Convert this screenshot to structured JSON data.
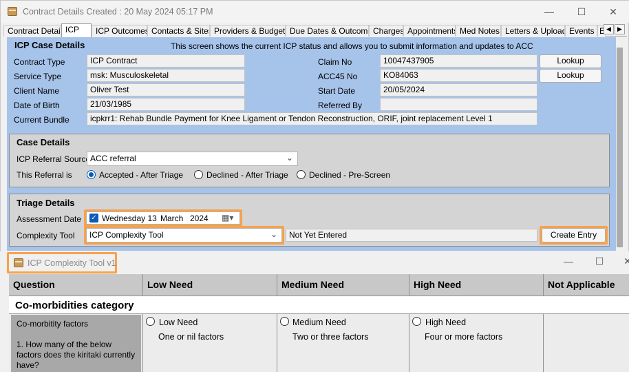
{
  "window": {
    "title": "Contract Details Created : 20 May 2024 05:17 PM"
  },
  "tabs": [
    "Contract Details",
    "ICP",
    "ICP Outcomes",
    "Contacts & Sites",
    "Providers & Budgets",
    "Due Dates & Outcomes",
    "Charges",
    "Appointments",
    "Med Notes",
    "Letters & Uploads",
    "Events",
    "E"
  ],
  "active_tab": "ICP",
  "icp": {
    "heading": "ICP Case Details",
    "info": "This screen shows the current ICP status and allows you to submit information and updates to ACC",
    "contract_type_label": "Contract Type",
    "contract_type": "ICP Contract",
    "service_type_label": "Service Type",
    "service_type": "msk: Musculoskeletal",
    "client_name_label": "Client Name",
    "client_name": "Oliver Test",
    "dob_label": "Date of Birth",
    "dob": "21/03/1985",
    "bundle_label": "Current Bundle",
    "bundle": "icpkrr1: Rehab Bundle Payment for Knee Ligament or Tendon Reconstruction, ORIF, joint replacement Level 1",
    "claim_no_label": "Claim No",
    "claim_no": "10047437905",
    "acc45_label": "ACC45 No",
    "acc45": "KO84063",
    "start_date_label": "Start Date",
    "start_date": "20/05/2024",
    "referred_by_label": "Referred By",
    "referred_by": "",
    "lookup_label": "Lookup"
  },
  "case": {
    "heading": "Case Details",
    "referral_source_label": "ICP Referral Source",
    "referral_source": "ACC referral",
    "referral_is_label": "This Referral is",
    "options": [
      "Accepted - After Triage",
      "Declined - After Triage",
      "Declined - Pre-Screen"
    ],
    "selected_option": "Accepted - After Triage"
  },
  "triage": {
    "heading": "Triage Details",
    "assessment_label": "Assessment Date",
    "assessment_day": "Wednesday 13",
    "assessment_month": "March",
    "assessment_year": "2024",
    "complexity_label": "Complexity Tool",
    "complexity_tool": "ICP Complexity Tool",
    "status": "Not Yet Entered",
    "create_label": "Create Entry"
  },
  "tool_window": {
    "title": "ICP Complexity Tool v1",
    "columns": [
      "Question",
      "Low Need",
      "Medium Need",
      "High Need",
      "Not Applicable"
    ],
    "category": "Co-morbidities category",
    "question": "Co-morbitity factors\n\n1. How many of the below factors does the kiritaki currently have?",
    "answers": [
      {
        "label": "Low Need",
        "detail": "One or nil factors"
      },
      {
        "label": "Medium Need",
        "detail": "Two or three factors"
      },
      {
        "label": "High Need",
        "detail": "Four or more factors"
      }
    ]
  },
  "colors": {
    "panel_blue": "#a6c3ea",
    "highlight_orange": "#f7a24a",
    "radio_blue": "#0a5bb8"
  }
}
